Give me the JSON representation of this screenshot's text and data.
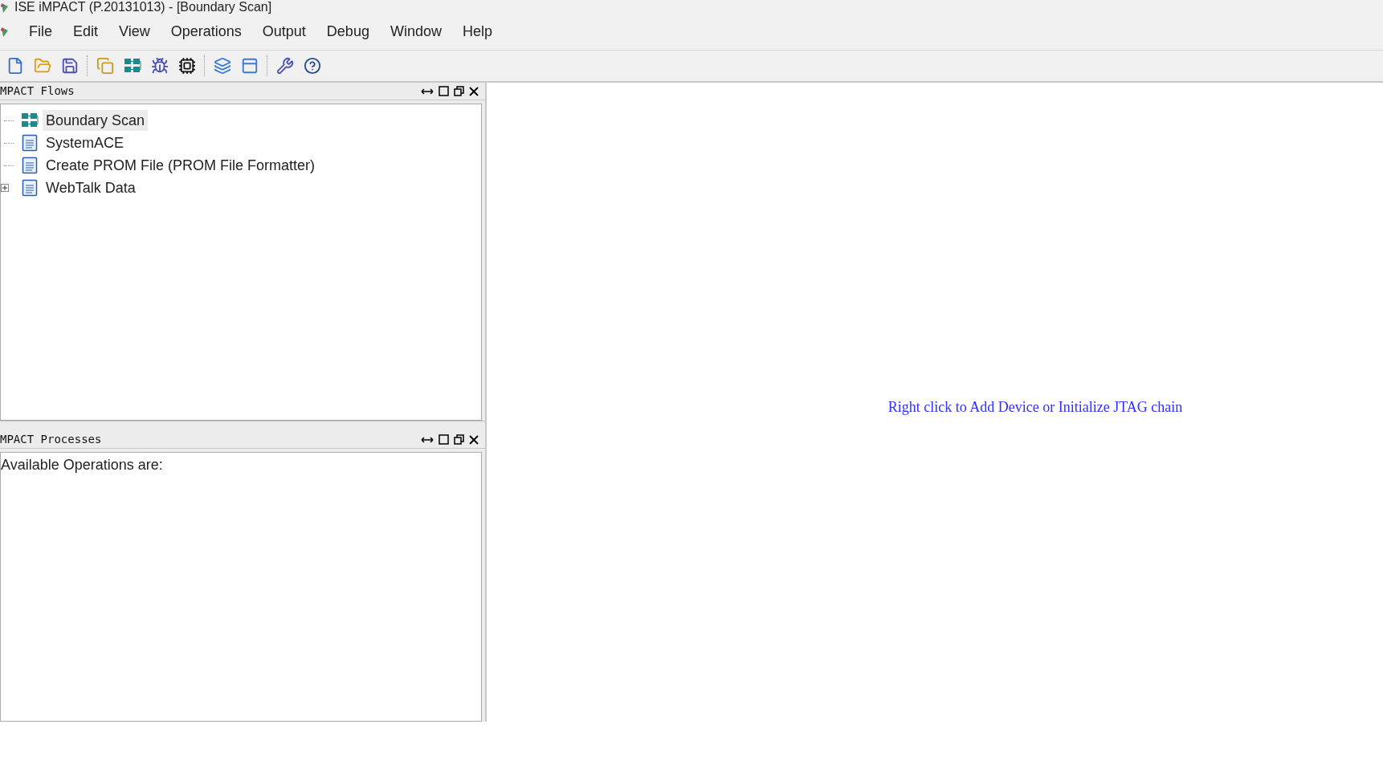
{
  "window": {
    "title": "ISE iMPACT (P.20131013) - [Boundary Scan]"
  },
  "menu": [
    "File",
    "Edit",
    "View",
    "Operations",
    "Output",
    "Debug",
    "Window",
    "Help"
  ],
  "flows_panel": {
    "title": "MPACT Flows",
    "items": [
      {
        "label": "Boundary Scan",
        "kind": "chain",
        "selected": true,
        "expander": false
      },
      {
        "label": "SystemACE",
        "kind": "document",
        "selected": false,
        "expander": false
      },
      {
        "label": "Create PROM File (PROM File Formatter)",
        "kind": "document",
        "selected": false,
        "expander": false
      },
      {
        "label": "WebTalk Data",
        "kind": "document",
        "selected": false,
        "expander": true
      }
    ]
  },
  "processes_panel": {
    "title": "MPACT Processes",
    "text": "Available Operations are:"
  },
  "canvas": {
    "hint": "Right click to Add Device or Initialize JTAG chain"
  }
}
